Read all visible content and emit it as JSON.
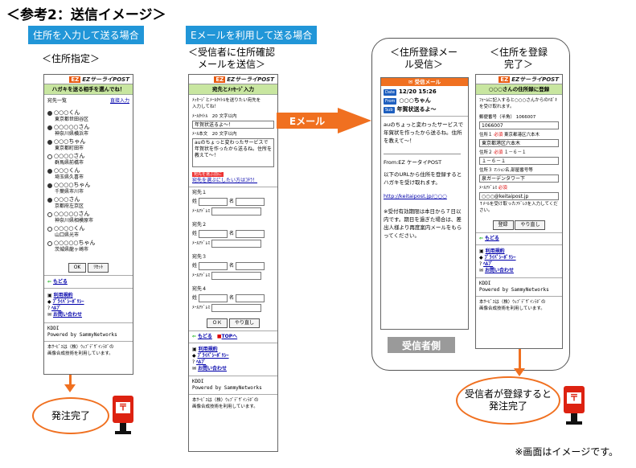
{
  "title": "＜参考2：送信イメージ＞",
  "section1_label": "住所を入力して送る場合",
  "section2_label": "Eメールを利用して送る場合",
  "captions": {
    "c1": "＜住所指定＞",
    "c2_line1": "＜受信者に住所確認",
    "c2_line2": "メールを送信＞",
    "c3_line1": "＜住所登録メー",
    "c3_line2": "ル受信＞",
    "c4_line1": "＜住所を登録",
    "c4_line2": "完了＞"
  },
  "logo": {
    "ez": "EZ",
    "text": "EZサーライPOST"
  },
  "phone1": {
    "header": "ハガキを送る相手を選んでね！",
    "list_label": "宛先一覧",
    "direct_link": "直接入力",
    "entries": [
      {
        "name": "○○○くん",
        "addr": "東京都世田谷区",
        "on": true
      },
      {
        "name": "○○○○○さん",
        "addr": "神奈川県横浜市",
        "on": true
      },
      {
        "name": "○○○ちゃん",
        "addr": "東京都町田市",
        "on": true
      },
      {
        "name": "○○○○さん",
        "addr": "群馬県前橋市",
        "on": false
      },
      {
        "name": "○○○くん",
        "addr": "埼玉県久喜市",
        "on": true
      },
      {
        "name": "○○○○ちゃん",
        "addr": "千葉県市川市",
        "on": true
      },
      {
        "name": "○○○さん",
        "addr": "京都府左京区",
        "on": true
      },
      {
        "name": "○○○○○さん",
        "addr": "神奈川県相模原市",
        "on": false
      },
      {
        "name": "○○○○くん",
        "addr": "山口県光市",
        "on": false
      },
      {
        "name": "○○○○○ちゃん",
        "addr": "茨城県龍ヶ崎市",
        "on": false
      }
    ],
    "ok": "OK",
    "reset": "ﾘｾｯﾄ",
    "back": "もどる",
    "links": [
      "利用規約",
      "ﾌﾟﾗｲﾊﾞｼｰﾎﾟﾘｼｰ",
      "ﾍﾙﾌﾟ",
      "お問い合わせ"
    ],
    "company": "KDDI",
    "powered": "Powered by SammyNetworks",
    "tech1": "本ｻｰﾋﾞｽは（株）ｳｪﾌﾞﾃﾞｻﾞｲﾝﾗﾎﾞの",
    "tech2": "画像合成技術を利用しています。"
  },
  "phone2": {
    "header": "宛先とﾒｯｾｰｼﾞ入力",
    "intro1": "ﾒｯｾｰｼﾞとﾒｰﾙﾀｲﾄﾙを送りたい宛先を",
    "intro2": "入力してね！",
    "title_label": "ﾒｰﾙﾀｲﾄﾙ　20 文字以内",
    "title_value": "年賀状送るよ～！",
    "body_label": "ﾒｰﾙ本文　20 文字以内",
    "body_value": "auのちょっと変わったサービスで年賀状を作ったから送るね。住所を教えて～！",
    "notice_badge": "宛先を選ぶ前に",
    "notice_link": "宛先を選ぶにしたい方はｺﾁﾗ！",
    "recipients": [
      "宛先１",
      "宛先２",
      "宛先３",
      "宛先４"
    ],
    "sei": "姓",
    "mei": "名",
    "mail": "ﾒｰﾙｱﾄﾞﾚｽ",
    "ok": "ＯＫ",
    "redo": "やり直し",
    "back": "もどる",
    "top": "TOPへ",
    "links": [
      "利用規約",
      "ﾌﾟﾗｲﾊﾞｼｰﾎﾟﾘｼｰ",
      "ﾍﾙﾌﾟ",
      "お問い合わせ"
    ],
    "company": "KDDI",
    "powered": "Powered by SammyNetworks",
    "tech1": "本ｻｰﾋﾞｽは（株）ｳｪﾌﾞﾃﾞｻﾞｲﾝﾗﾎﾞの",
    "tech2": "画像合成技術を利用しています。"
  },
  "email_arrow": "Eメール",
  "phone3": {
    "header": "受信メール",
    "date_tag": "Date",
    "date": "12/20 15:26",
    "from_tag": "From",
    "from": "○○○ちゃん",
    "sub_tag": "Sub",
    "subject": "年賀状送るよ～",
    "body": "auのちょっと変わったサービスで年賀状を作ったから送るね。住所を教えて～！",
    "rule": "――――――――――――――――",
    "from_line": "From:EZ ケータイPOST",
    "instr": "以下のURLから住所を登録するとハガキを受け取れます。",
    "url": "http://keitaipost.jp/○○○",
    "warning": "※受付有効期限は本日から７日以内です。期日を過ぎた場合は、差出人様より再度案内メールをもらってください。"
  },
  "phone4": {
    "header": "○○○さんの住所録に登録",
    "intro": "ﾌｫｰﾑに記入すると○○○さんからのﾊｶﾞｷを受け取れます。",
    "zip_label": "郵便番号（半角）",
    "zip_hint": "1066007",
    "zip_value": "1066007",
    "addr1_label": "住所１",
    "addr1_hint": "東京都港区六本木",
    "addr1_value": "東京都港区六本木",
    "addr2_label": "住所２",
    "addr2_hint": "１－６－１",
    "addr2_value": "１－６－１",
    "addr3_label": "住所３",
    "addr3_hint": "ﾏﾝｼｮﾝ名,部屋番号等",
    "addr3_value": "泉ガーデンタワー下",
    "required": "必須",
    "mail_label": "ﾒｰﾙｱﾄﾞﾚｽ",
    "mail_required": "必須",
    "mail_value": "○○○@keitaipost.jp",
    "mail_note": "↑ﾒｰﾙを受け取ったｱﾄﾞﾚｽを入力してください。",
    "register": "登録",
    "redo": "やり直し",
    "back": "もどる",
    "links": [
      "利用規約",
      "ﾌﾟﾗｲﾊﾞｼｰﾎﾟﾘｼｰ",
      "ﾍﾙﾌﾟ",
      "お問い合わせ"
    ],
    "company": "KDDI",
    "powered": "Powered by SammyNetworks",
    "tech1": "本ｻｰﾋﾞｽは（株）ｳｪﾌﾞﾃﾞｻﾞｲﾝﾗﾎﾞの",
    "tech2": "画像合成技術を利用しています。"
  },
  "recipient_side": "受信者側",
  "done1": "発注完了",
  "done2_line1": "受信者が登録すると",
  "done2_line2": "発注完了",
  "postbox_glyph": "〒",
  "note": "※画面はイメージです。",
  "colors": {
    "accent": "#f07020",
    "label_blue": "#2196d8",
    "header_green": "#c8e6a0",
    "postbox_red": "#d21"
  }
}
